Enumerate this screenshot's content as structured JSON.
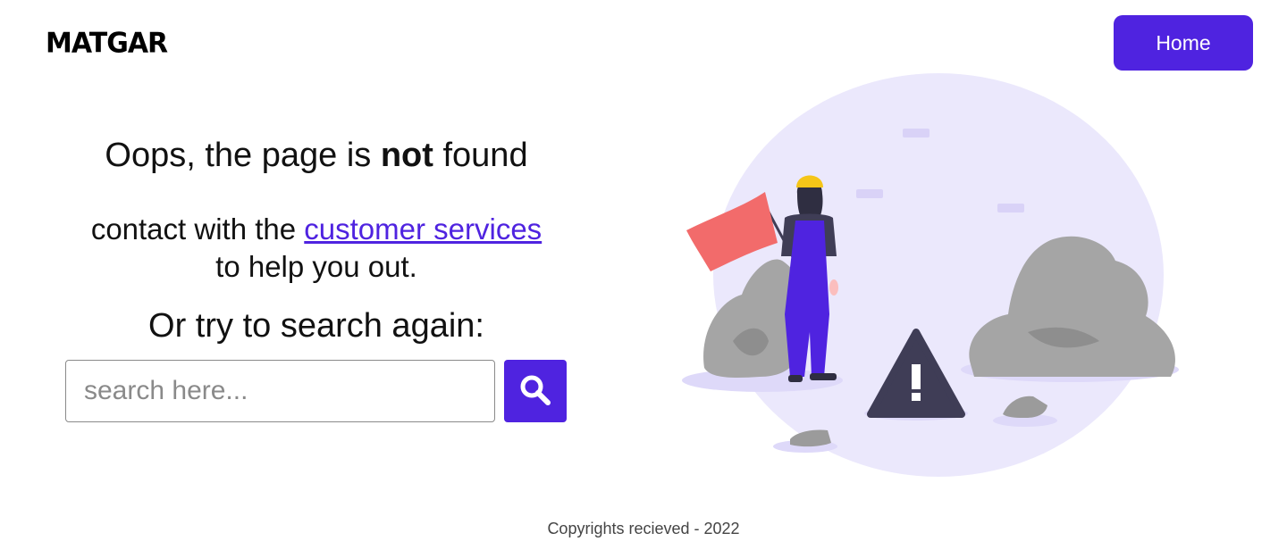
{
  "header": {
    "logo_text": "MATGAR",
    "home_label": "Home"
  },
  "message": {
    "headline_prefix": "Oops, the page is ",
    "headline_bold": "not",
    "headline_suffix": " found",
    "contact_prefix": "contact with the ",
    "contact_link": "customer services",
    "contact_suffix": "to help you out.",
    "retry": "Or try to search again:"
  },
  "search": {
    "placeholder": "search here...",
    "button_icon": "search-icon"
  },
  "illustration": {
    "accent": "#4f23e0",
    "bg_circle": "#ebe8fc",
    "rock": "#a5a5a5",
    "flag": "#f26b6b",
    "warning": "#3f3d56"
  },
  "footer": {
    "text": "Copyrights recieved - 2022"
  }
}
